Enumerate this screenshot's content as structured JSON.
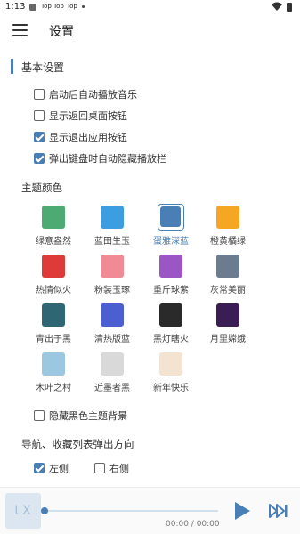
{
  "status_bar": {
    "time": "1:13",
    "notifications": [
      "Top",
      "Top",
      "Top"
    ]
  },
  "app_bar": {
    "title": "设置",
    "menu_icon": "menu-icon"
  },
  "basic_settings": {
    "heading": "基本设置",
    "options": [
      {
        "label": "启动后自动播放音乐",
        "checked": false
      },
      {
        "label": "显示返回桌面按钮",
        "checked": false
      },
      {
        "label": "显示退出应用按钮",
        "checked": true
      },
      {
        "label": "弹出键盘时自动隐藏播放栏",
        "checked": true
      }
    ]
  },
  "theme": {
    "heading": "主题颜色",
    "selected": "蛋雅深蓝",
    "items": [
      {
        "name": "绿意盎然",
        "color": "#4daa72"
      },
      {
        "name": "蓝田生玉",
        "color": "#3c9ee0"
      },
      {
        "name": "蛋雅深蓝",
        "color": "#4a7fb5"
      },
      {
        "name": "橙黄橘绿",
        "color": "#f5a623"
      },
      {
        "name": "热情似火",
        "color": "#de3a3a"
      },
      {
        "name": "粉装玉琢",
        "color": "#f08a94"
      },
      {
        "name": "重斤球紫",
        "color": "#9b55c4"
      },
      {
        "name": "灰常美丽",
        "color": "#6b7c8f"
      },
      {
        "name": "青出于黑",
        "color": "#2f6673"
      },
      {
        "name": "清热版蓝",
        "color": "#4c5fd0"
      },
      {
        "name": "黑灯瞎火",
        "color": "#2a2a2a"
      },
      {
        "name": "月里嫦娥",
        "color": "#3b1d55"
      },
      {
        "name": "木叶之村",
        "color": "#9cc7e0"
      },
      {
        "name": "近墨者黑",
        "color": "#d9d9d9"
      },
      {
        "name": "新年快乐",
        "color": "#f2e4d0"
      }
    ]
  },
  "hide_black_theme_bg": {
    "label": "隐藏黑色主题背景",
    "checked": false
  },
  "popup_direction": {
    "heading": "导航、收藏列表弹出方向",
    "left": {
      "label": "左侧",
      "checked": true
    },
    "right": {
      "label": "右侧",
      "checked": false
    }
  },
  "player": {
    "logo_text": "LX",
    "time": "00:00 / 00:00",
    "progress": 0,
    "accent": "#4a7fb5"
  }
}
